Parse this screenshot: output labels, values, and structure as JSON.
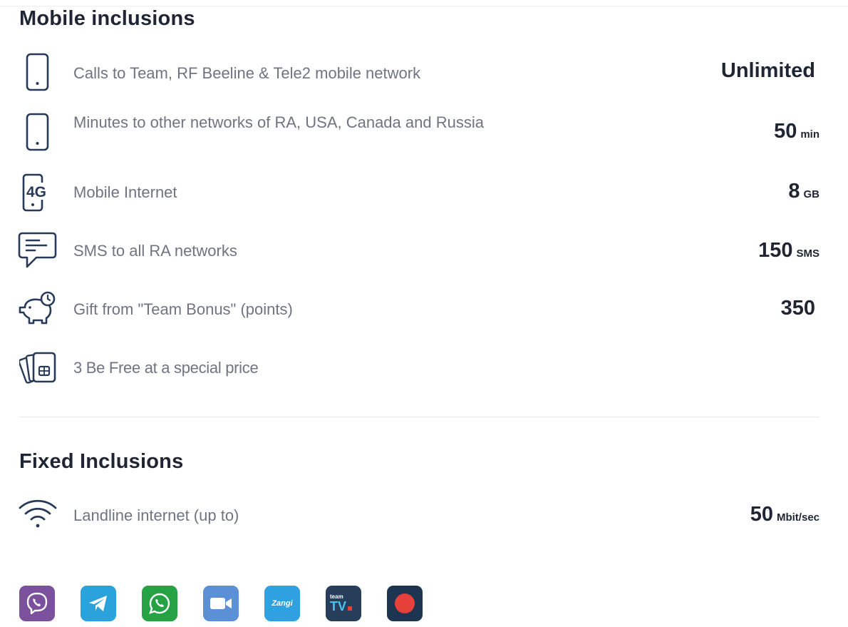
{
  "mobile": {
    "title": "Mobile inclusions",
    "items": [
      {
        "icon": "smartphone-icon",
        "label": "Calls to Team, RF Beeline & Tele2 mobile network",
        "value": "Unlimited",
        "unit": ""
      },
      {
        "icon": "smartphone-icon",
        "label": "Minutes to other networks of RA, USA, Canada and Russia",
        "value": "50",
        "unit": "min"
      },
      {
        "icon": "phone-4g-icon",
        "label": "Mobile Internet",
        "value": "8",
        "unit": "GB"
      },
      {
        "icon": "sms-bubble-icon",
        "label": "SMS to all RA networks",
        "value": "150",
        "unit": "SMS"
      },
      {
        "icon": "piggy-bank-icon",
        "label": "Gift from \"Team Bonus\" (points)",
        "value": "350",
        "unit": ""
      },
      {
        "icon": "sim-cards-icon",
        "label": "3 Be Free at a special price",
        "value": "",
        "unit": ""
      }
    ]
  },
  "fixed": {
    "title": "Fixed Inclusions",
    "items": [
      {
        "icon": "wifi-icon",
        "label": "Landline internet (up to)",
        "value": "50",
        "unit": "Mbit/sec"
      }
    ]
  },
  "apps": [
    {
      "name": "Viber",
      "icon": "viber-icon",
      "color": "#7b519d"
    },
    {
      "name": "Telegram",
      "icon": "telegram-icon",
      "color": "#2aa3dc"
    },
    {
      "name": "WhatsApp",
      "icon": "whatsapp-icon",
      "color": "#25a244"
    },
    {
      "name": "Zoom",
      "icon": "zoom-icon",
      "color": "#5b8fd6"
    },
    {
      "name": "Zangi",
      "icon": "zangi-icon",
      "color": "#2fa0e0",
      "text": "Zangi"
    },
    {
      "name": "Team TV",
      "icon": "team-tv-icon",
      "color": "#263e5a",
      "small_text": "team",
      "big_text": "TV"
    },
    {
      "name": "Record",
      "icon": "record-icon",
      "color": "#1d3550"
    }
  ]
}
